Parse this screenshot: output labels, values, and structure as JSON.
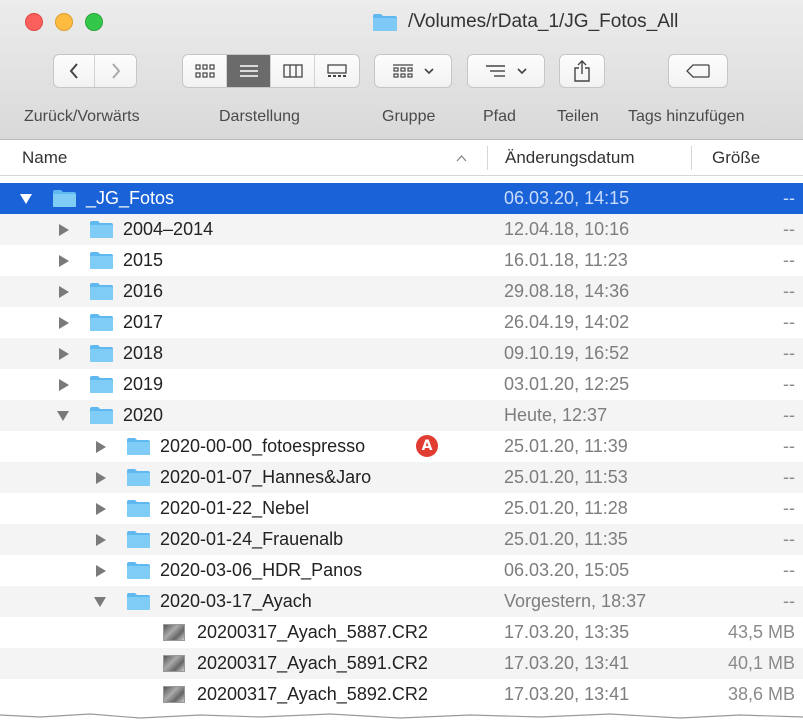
{
  "window": {
    "title": "/Volumes/rData_1/JG_Fotos_All"
  },
  "toolbar": {
    "labels": {
      "back_forward": "Zurück/Vorwärts",
      "view": "Darstellung",
      "group": "Gruppe",
      "path": "Pfad",
      "share": "Teilen",
      "tags": "Tags hinzufügen"
    }
  },
  "columns": {
    "name": "Name",
    "date": "Änderungsdatum",
    "size": "Größe"
  },
  "rows": [
    {
      "name": "_JG_Fotos",
      "date": "06.03.20, 14:15",
      "size": "--",
      "kind": "folder",
      "level": 0,
      "expanded": true,
      "selected": true
    },
    {
      "name": "2004–2014",
      "date": "12.04.18, 10:16",
      "size": "--",
      "kind": "folder",
      "level": 1,
      "expanded": false
    },
    {
      "name": "2015",
      "date": "16.01.18, 11:23",
      "size": "--",
      "kind": "folder",
      "level": 1,
      "expanded": false
    },
    {
      "name": "2016",
      "date": "29.08.18, 14:36",
      "size": "--",
      "kind": "folder",
      "level": 1,
      "expanded": false
    },
    {
      "name": "2017",
      "date": "26.04.19, 14:02",
      "size": "--",
      "kind": "folder",
      "level": 1,
      "expanded": false
    },
    {
      "name": "2018",
      "date": "09.10.19, 16:52",
      "size": "--",
      "kind": "folder",
      "level": 1,
      "expanded": false
    },
    {
      "name": "2019",
      "date": "03.01.20, 12:25",
      "size": "--",
      "kind": "folder",
      "level": 1,
      "expanded": false
    },
    {
      "name": "2020",
      "date": "Heute, 12:37",
      "size": "--",
      "kind": "folder",
      "level": 1,
      "expanded": true
    },
    {
      "name": "2020-00-00_fotoespresso",
      "date": "25.01.20, 11:39",
      "size": "--",
      "kind": "folder",
      "level": 2,
      "expanded": false,
      "badge": "A"
    },
    {
      "name": "2020-01-07_Hannes&Jaro",
      "date": "25.01.20, 11:53",
      "size": "--",
      "kind": "folder",
      "level": 2,
      "expanded": false
    },
    {
      "name": "2020-01-22_Nebel",
      "date": "25.01.20, 11:28",
      "size": "--",
      "kind": "folder",
      "level": 2,
      "expanded": false
    },
    {
      "name": "2020-01-24_Frauenalb",
      "date": "25.01.20, 11:35",
      "size": "--",
      "kind": "folder",
      "level": 2,
      "expanded": false
    },
    {
      "name": "2020-03-06_HDR_Panos",
      "date": "06.03.20, 15:05",
      "size": "--",
      "kind": "folder",
      "level": 2,
      "expanded": false
    },
    {
      "name": "2020-03-17_Ayach",
      "date": "Vorgestern, 18:37",
      "size": "--",
      "kind": "folder",
      "level": 2,
      "expanded": true
    },
    {
      "name": "20200317_Ayach_5887.CR2",
      "date": "17.03.20, 13:35",
      "size": "43,5 MB",
      "kind": "file",
      "level": 3
    },
    {
      "name": "20200317_Ayach_5891.CR2",
      "date": "17.03.20, 13:41",
      "size": "40,1 MB",
      "kind": "file",
      "level": 3
    },
    {
      "name": "20200317_Ayach_5892.CR2",
      "date": "17.03.20, 13:41",
      "size": "38,6 MB",
      "kind": "file",
      "level": 3
    }
  ],
  "colors": {
    "selection": "#1a62d8",
    "folder": "#5fb8f0",
    "badge": "#e03c31"
  }
}
